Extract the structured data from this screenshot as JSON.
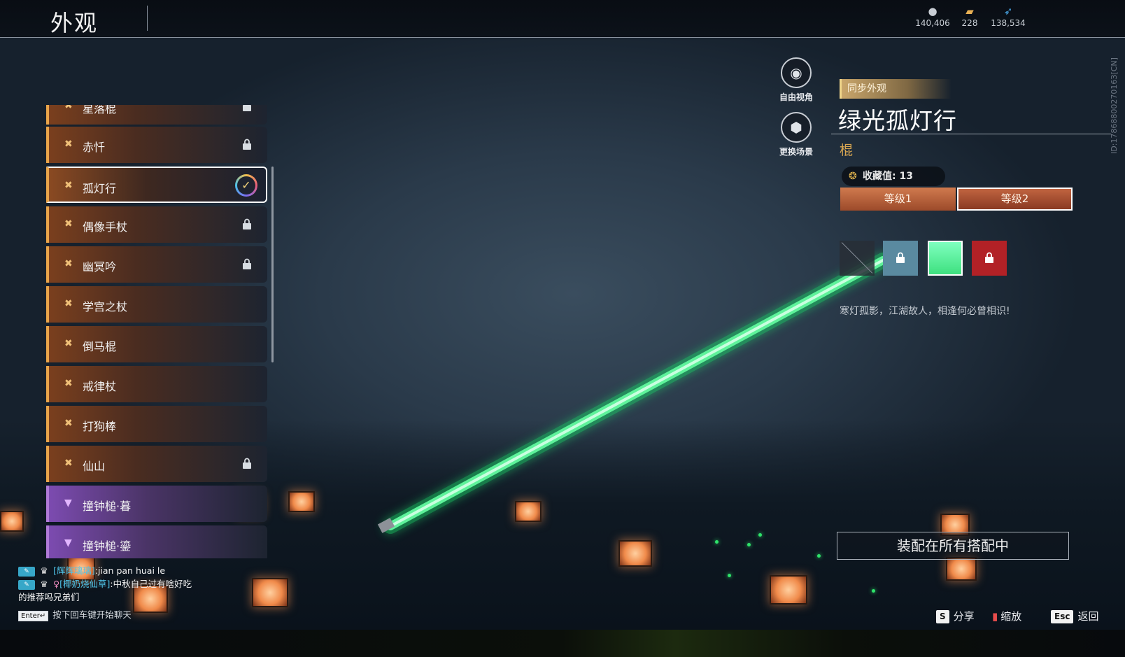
{
  "header": {
    "title": "外观",
    "currencies": [
      {
        "icon": "coin-icon",
        "value": "140,406"
      },
      {
        "icon": "ticket-icon",
        "value": "228"
      },
      {
        "icon": "feather-icon",
        "value": "138,534"
      }
    ]
  },
  "player_id": "ID:1786880027016З[CN]",
  "weapon_list": {
    "items": [
      {
        "label": "星落棍",
        "locked": true,
        "rarity": "orange"
      },
      {
        "label": "赤忏",
        "locked": true,
        "rarity": "orange"
      },
      {
        "label": "孤灯行",
        "locked": false,
        "selected": true,
        "rarity": "orange"
      },
      {
        "label": "偶像手杖",
        "locked": true,
        "rarity": "orange"
      },
      {
        "label": "幽冥吟",
        "locked": true,
        "rarity": "orange"
      },
      {
        "label": "学宫之杖",
        "locked": false,
        "rarity": "orange"
      },
      {
        "label": "倒马棍",
        "locked": false,
        "rarity": "orange"
      },
      {
        "label": "戒律杖",
        "locked": false,
        "rarity": "orange"
      },
      {
        "label": "打狗棒",
        "locked": false,
        "rarity": "orange"
      },
      {
        "label": "仙山",
        "locked": true,
        "rarity": "orange"
      },
      {
        "label": "撞钟槌·暮",
        "locked": false,
        "rarity": "purple"
      },
      {
        "label": "撞钟槌·鎏",
        "locked": false,
        "rarity": "purple"
      }
    ]
  },
  "view_buttons": {
    "free_view": "自由视角",
    "change_scene": "更换场景"
  },
  "detail": {
    "sync_tag": "同步外观",
    "title": "绿光孤灯行",
    "type": "棍",
    "collect_label": "收藏值: 13",
    "levels": [
      "等级1",
      "等级2"
    ],
    "selected_level": 1,
    "swatches": [
      {
        "name": "none",
        "color": "#2a2e36",
        "locked": false
      },
      {
        "name": "blue",
        "color": "#5a8aa0",
        "locked": true
      },
      {
        "name": "green",
        "color": "#5ef29a",
        "locked": false,
        "selected": true
      },
      {
        "name": "red",
        "color": "#b22126",
        "locked": true
      }
    ],
    "description": "寒灯孤影，江湖故人，相逢何必曾相识!",
    "equip_button": "装配在所有搭配中"
  },
  "chat": {
    "messages": [
      {
        "name": "[辉辉璃璃]",
        "text": ":jian pan huai le",
        "female": false
      },
      {
        "name": "[椰奶烧仙草]",
        "text": ":中秋自己过有啥好吃",
        "female": true
      }
    ],
    "continuation": "的推荐吗兄弟们",
    "hint_key": "Enter↵",
    "hint_text": "按下回车键开始聊天"
  },
  "hotkeys": [
    {
      "key": "S",
      "label": "分享"
    },
    {
      "key": "book-icon",
      "label": "缩放"
    },
    {
      "key": "Esc",
      "label": "返回"
    }
  ],
  "colors": {
    "accent_orange": "#e9a54a",
    "accent_gold": "#d9a752",
    "saber_green": "#3ee07f",
    "rarity_purple": "#7c4bb0"
  }
}
